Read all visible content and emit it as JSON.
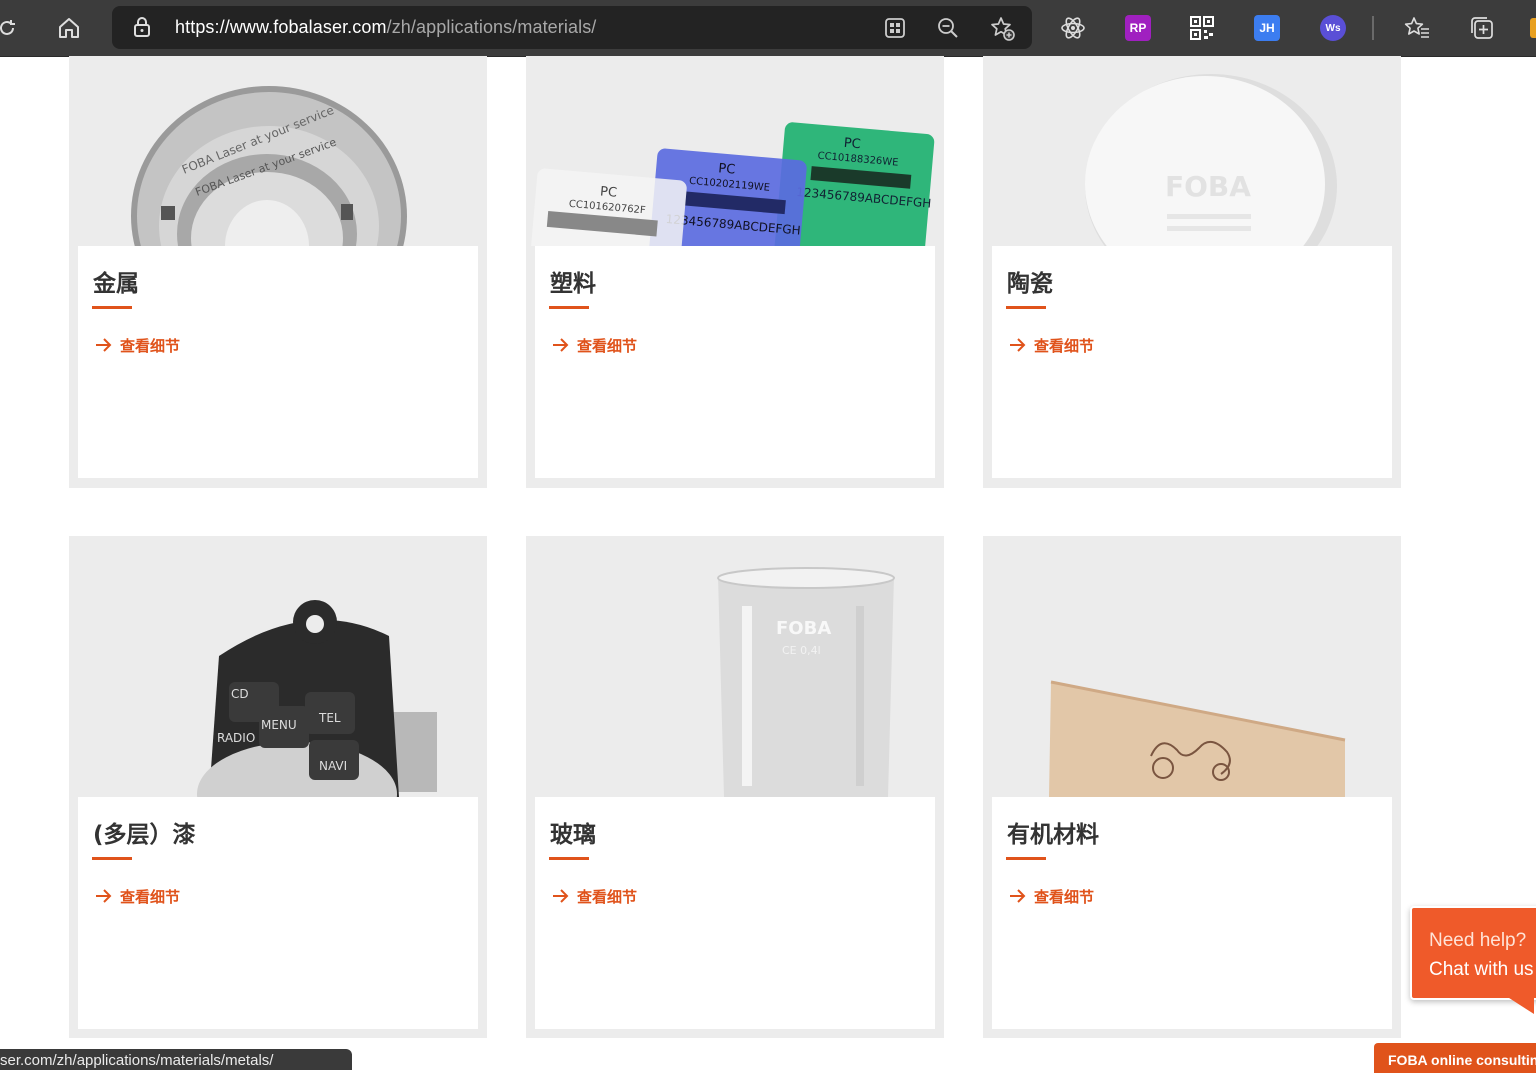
{
  "browser": {
    "url_main": "https://www.fobalaser.com",
    "url_path": "/zh/applications/materials/",
    "toolbar_icons": [
      "reload-icon",
      "home-icon",
      "lock-icon",
      "apps-icon",
      "zoom-out-icon",
      "add-favorite-icon",
      "react-devtools-icon",
      "rp-extension-icon",
      "qr-code-icon",
      "jh-extension-icon",
      "ws-extension-icon",
      "favorites-icon",
      "collections-icon"
    ],
    "ext_rp": "RP",
    "ext_jh": "JH",
    "ext_ws": "Ws"
  },
  "cards": [
    {
      "title": "金属",
      "link": "查看细节"
    },
    {
      "title": "塑料",
      "link": "查看细节"
    },
    {
      "title": "陶瓷",
      "link": "查看细节"
    },
    {
      "title": "(多层）漆",
      "link": "查看细节"
    },
    {
      "title": "玻璃",
      "link": "查看细节"
    },
    {
      "title": "有机材料",
      "link": "查看细节"
    }
  ],
  "images": {
    "bearing_text": "FOBA Laser at your service",
    "plastic_tag_1": {
      "label": "PC",
      "code": "CC101620762F"
    },
    "plastic_tag_2": {
      "label": "PC",
      "code": "CC10202119WE",
      "line": "123456789ABCDEFGH"
    },
    "plastic_tag_3": {
      "label": "PC",
      "code": "CC10188326WE",
      "line": "123456789ABCDEFGH"
    },
    "ceramic_logo": "FOBA",
    "remote_keys": [
      "CD",
      "MENU",
      "TEL",
      "RADIO",
      "NAVI"
    ],
    "glass_logo": "FOBA",
    "glass_mark": "CE 0,4l"
  },
  "status_url": "ser.com/zh/applications/materials/metals/",
  "chat": {
    "line1": "Need help?",
    "line2": "Chat with us",
    "consult": "FOBA online consulting"
  },
  "colors": {
    "accent": "#e0531b",
    "toolbar": "#3c3c3c",
    "card_bg": "#ececec"
  }
}
